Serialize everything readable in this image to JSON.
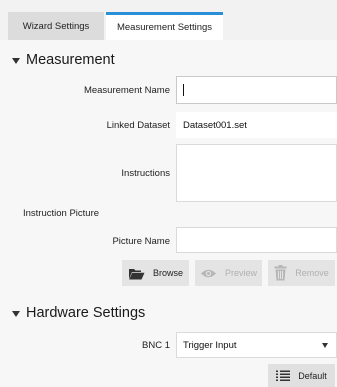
{
  "tabs": [
    {
      "label": "Wizard Settings",
      "active": false
    },
    {
      "label": "Measurement Settings",
      "active": true
    }
  ],
  "accent_color": "#2a8fd6",
  "measurement": {
    "header": "Measurement",
    "name_label": "Measurement Name",
    "name_value": "",
    "dataset_label": "Linked Dataset",
    "dataset_value": "Dataset001.set",
    "instructions_label": "Instructions",
    "instructions_value": "",
    "picture_section_label": "Instruction Picture",
    "picture_name_label": "Picture Name",
    "picture_name_value": "",
    "buttons": {
      "browse": "Browse",
      "preview": "Preview",
      "remove": "Remove"
    },
    "icons": {
      "browse": "folder-open-icon",
      "preview": "eye-icon",
      "remove": "trash-icon"
    }
  },
  "hardware": {
    "header": "Hardware Settings",
    "bnc_label": "BNC 1",
    "bnc_value": "Trigger Input",
    "default_button": "Default",
    "default_icon": "list-icon"
  }
}
